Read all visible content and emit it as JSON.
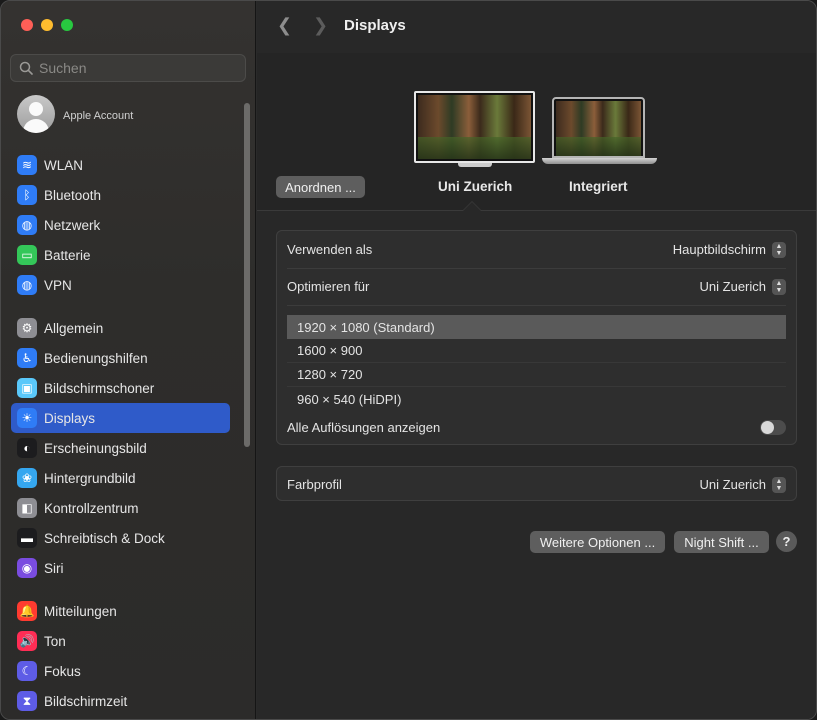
{
  "sidebar": {
    "search_placeholder": "Suchen",
    "account_label": "Apple Account",
    "groups": [
      [
        {
          "label": "WLAN",
          "icon": "wifi-icon",
          "color": "#2f7cf6",
          "glyph": "≋"
        },
        {
          "label": "Bluetooth",
          "icon": "bluetooth-icon",
          "color": "#2f7cf6",
          "glyph": "ᛒ"
        },
        {
          "label": "Netzwerk",
          "icon": "globe-icon",
          "color": "#2f7cf6",
          "glyph": "◍"
        },
        {
          "label": "Batterie",
          "icon": "battery-icon",
          "color": "#34c759",
          "glyph": "▭"
        },
        {
          "label": "VPN",
          "icon": "vpn-icon",
          "color": "#2f7cf6",
          "glyph": "◍"
        }
      ],
      [
        {
          "label": "Allgemein",
          "icon": "gear-icon",
          "color": "#8e8e93",
          "glyph": "⚙"
        },
        {
          "label": "Bedienungshilfen",
          "icon": "accessibility-icon",
          "color": "#2f7cf6",
          "glyph": "♿"
        },
        {
          "label": "Bildschirmschoner",
          "icon": "screensaver-icon",
          "color": "#5ac8fa",
          "glyph": "▣"
        },
        {
          "label": "Displays",
          "icon": "brightness-icon",
          "color": "#2f7cf6",
          "glyph": "☀"
        },
        {
          "label": "Erscheinungsbild",
          "icon": "appearance-icon",
          "color": "#1c1c1e",
          "glyph": "◐"
        },
        {
          "label": "Hintergrundbild",
          "icon": "wallpaper-icon",
          "color": "#35a7f0",
          "glyph": "❀"
        },
        {
          "label": "Kontrollzentrum",
          "icon": "control-center-icon",
          "color": "#8e8e93",
          "glyph": "◧"
        },
        {
          "label": "Schreibtisch & Dock",
          "icon": "dock-icon",
          "color": "#1c1c1e",
          "glyph": "▬"
        },
        {
          "label": "Siri",
          "icon": "siri-icon",
          "color": "#7a4ce0",
          "glyph": "◉"
        }
      ],
      [
        {
          "label": "Mitteilungen",
          "icon": "notifications-icon",
          "color": "#ff3b30",
          "glyph": "🔔"
        },
        {
          "label": "Ton",
          "icon": "sound-icon",
          "color": "#ff2d55",
          "glyph": "🔊"
        },
        {
          "label": "Fokus",
          "icon": "moon-icon",
          "color": "#5e5ce6",
          "glyph": "☾"
        },
        {
          "label": "Bildschirmzeit",
          "icon": "hourglass-icon",
          "color": "#5e5ce6",
          "glyph": "⧗"
        }
      ]
    ],
    "selected": "Displays"
  },
  "main": {
    "title": "Displays",
    "arrange_button": "Anordnen ...",
    "displays": [
      "Uni Zuerich",
      "Integriert"
    ],
    "use_as": {
      "label": "Verwenden als",
      "value": "Hauptbildschirm"
    },
    "optimize_for": {
      "label": "Optimieren für",
      "value": "Uni Zuerich"
    },
    "resolutions": [
      "1920 × 1080 (Standard)",
      "1600 × 900",
      "1280 × 720",
      "960 × 540 (HiDPI)"
    ],
    "selected_resolution": "1920 × 1080 (Standard)",
    "show_all": {
      "label": "Alle Auflösungen anzeigen",
      "on": false
    },
    "color_profile": {
      "label": "Farbprofil",
      "value": "Uni Zuerich"
    },
    "more_options_button": "Weitere Optionen ...",
    "night_shift_button": "Night Shift ...",
    "help_glyph": "?"
  }
}
